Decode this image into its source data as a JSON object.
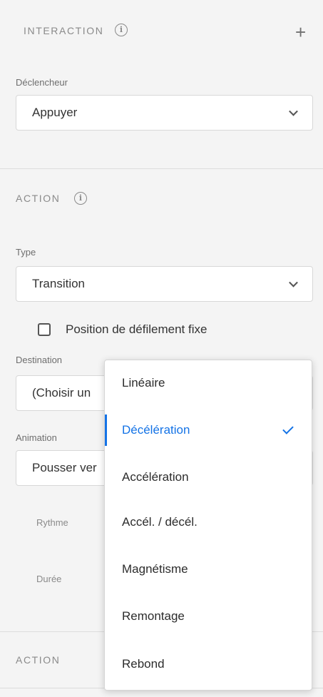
{
  "interaction": {
    "title": "INTERACTION",
    "trigger_label": "Déclencheur",
    "trigger_value": "Appuyer"
  },
  "action": {
    "title": "ACTION",
    "type_label": "Type",
    "type_value": "Transition",
    "fixed_scroll_label": "Position de défilement fixe",
    "fixed_scroll_checked": false,
    "destination_label": "Destination",
    "destination_value": "(Choisir un",
    "animation_label": "Animation",
    "animation_value": "Pousser ver",
    "rhythm_label": "Rythme",
    "duration_label": "Durée"
  },
  "action2": {
    "title": "ACTION"
  },
  "easing_menu": {
    "selected": "Décélération",
    "items": [
      "Linéaire",
      "Décélération",
      "Accélération",
      "Accél. / décél.",
      "Magnétisme",
      "Remontage",
      "Rebond"
    ]
  },
  "colors": {
    "accent": "#1473e6",
    "panel_bg": "#f4f4f4"
  }
}
